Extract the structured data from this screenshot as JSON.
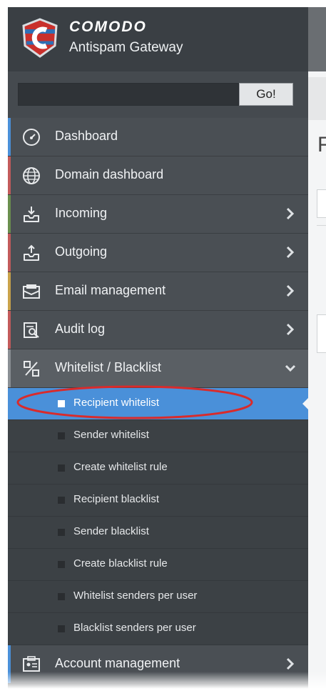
{
  "brand": {
    "name": "COMODO",
    "product": "Antispam Gateway"
  },
  "search": {
    "placeholder": "",
    "button_label": "Go!"
  },
  "nav": [
    {
      "id": "dashboard",
      "label": "Dashboard",
      "icon": "gauge-icon",
      "has_children": false,
      "accent": "#4a90d9"
    },
    {
      "id": "domain-dashboard",
      "label": "Domain dashboard",
      "icon": "globe-icon",
      "has_children": false,
      "accent": "#c25b5b"
    },
    {
      "id": "incoming",
      "label": "Incoming",
      "icon": "inbox-download-icon",
      "has_children": true,
      "accent": "#6a8f4e"
    },
    {
      "id": "outgoing",
      "label": "Outgoing",
      "icon": "inbox-upload-icon",
      "has_children": true,
      "accent": "#c25b5b"
    },
    {
      "id": "email-management",
      "label": "Email management",
      "icon": "envelope-icon",
      "has_children": true,
      "accent": "#c9a24a"
    },
    {
      "id": "audit-log",
      "label": "Audit log",
      "icon": "magnifier-report-icon",
      "has_children": true,
      "accent": "#c25b5b"
    },
    {
      "id": "whitelist-blacklist",
      "label": "Whitelist / Blacklist",
      "icon": "percent-icon",
      "has_children": true,
      "expanded": true,
      "accent": "#8a8f94"
    }
  ],
  "whitelist_submenu": [
    {
      "label": "Recipient whitelist",
      "active": true
    },
    {
      "label": "Sender whitelist",
      "active": false
    },
    {
      "label": "Create whitelist rule",
      "active": false
    },
    {
      "label": "Recipient blacklist",
      "active": false
    },
    {
      "label": "Sender blacklist",
      "active": false
    },
    {
      "label": "Create blacklist rule",
      "active": false
    },
    {
      "label": "Whitelist senders per user",
      "active": false
    },
    {
      "label": "Blacklist senders per user",
      "active": false
    }
  ],
  "nav_bottom": {
    "label": "Account management",
    "icon": "id-card-icon",
    "has_children": true,
    "accent": "#4a90d9"
  },
  "colors": {
    "sidebar_bg": "#3e4347",
    "active_item": "#4a90d9",
    "highlight_ring": "#d92b2b"
  },
  "right_panel": {
    "partial_heading": "F"
  }
}
